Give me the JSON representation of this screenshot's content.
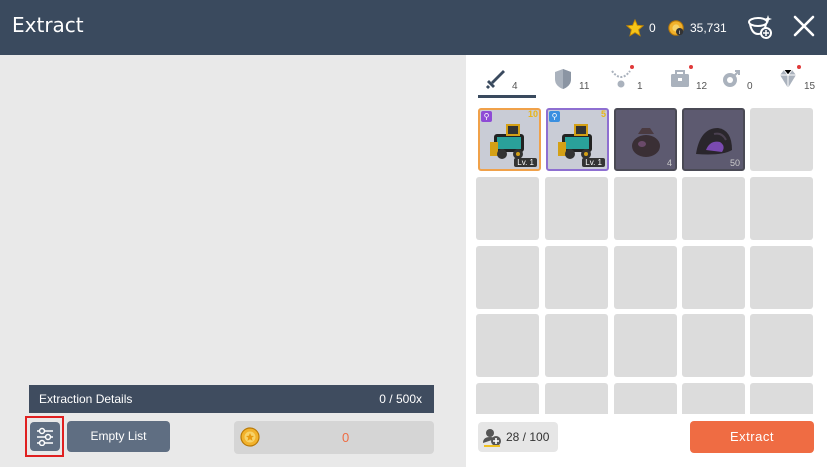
{
  "header": {
    "title": "Extract",
    "star_count": "0",
    "coin_count": "35,731"
  },
  "tabs": [
    {
      "name": "weapon",
      "count": "4",
      "new": false
    },
    {
      "name": "shield",
      "count": "11",
      "new": false
    },
    {
      "name": "necklace",
      "count": "1",
      "new": true
    },
    {
      "name": "chest",
      "count": "12",
      "new": true
    },
    {
      "name": "accessory",
      "count": "0",
      "new": false
    },
    {
      "name": "gem",
      "count": "15",
      "new": true
    }
  ],
  "items": [
    {
      "name": "cannon-weapon",
      "level": "Lv. 1",
      "grade": "10",
      "frame": "orange"
    },
    {
      "name": "cannon-weapon",
      "level": "Lv. 1",
      "grade": "5",
      "frame": "purple"
    },
    {
      "name": "dark-pouch",
      "qty": "4"
    },
    {
      "name": "dark-ore",
      "qty": "50"
    }
  ],
  "inventory": {
    "count": "28 / 100"
  },
  "extract_label": "Extract",
  "details": {
    "label": "Extraction Details",
    "value": "0 / 500x"
  },
  "empty_list_label": "Empty List",
  "cost": "0",
  "colors": {
    "header": "#3a4a5e",
    "accent": "#ef6c43",
    "button": "#5f6e82"
  }
}
